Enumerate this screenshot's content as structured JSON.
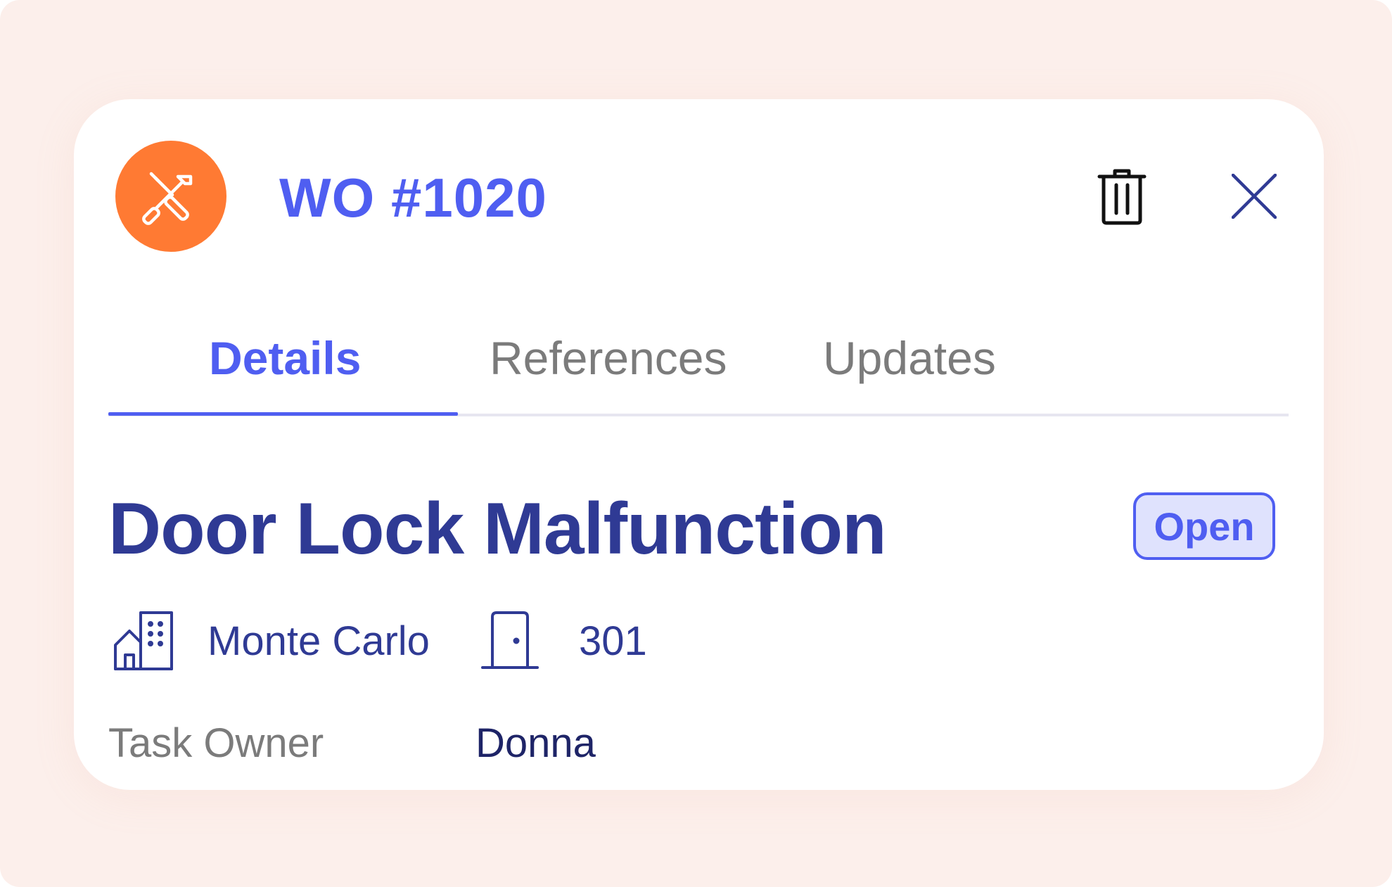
{
  "header": {
    "title": "WO #1020",
    "avatar_icon": "tools-icon",
    "avatar_color": "#ff7a33",
    "actions": [
      {
        "name": "delete",
        "icon": "trash-icon"
      },
      {
        "name": "close",
        "icon": "close-icon"
      }
    ]
  },
  "tabs": [
    {
      "label": "Details",
      "active": true
    },
    {
      "label": "References",
      "active": false
    },
    {
      "label": "Updates",
      "active": false
    }
  ],
  "task": {
    "title": "Door Lock Malfunction",
    "status": "Open",
    "building": {
      "icon": "building-icon",
      "name": "Monte Carlo"
    },
    "unit": {
      "icon": "door-icon",
      "number": "301"
    },
    "owner_label": "Task Owner",
    "owner_value": "Donna"
  },
  "colors": {
    "accent": "#4f5ef1",
    "title": "#2f3a94",
    "muted": "#7b7b7b",
    "badge_bg": "#dfe2fd",
    "backdrop": "#fcefeb"
  }
}
